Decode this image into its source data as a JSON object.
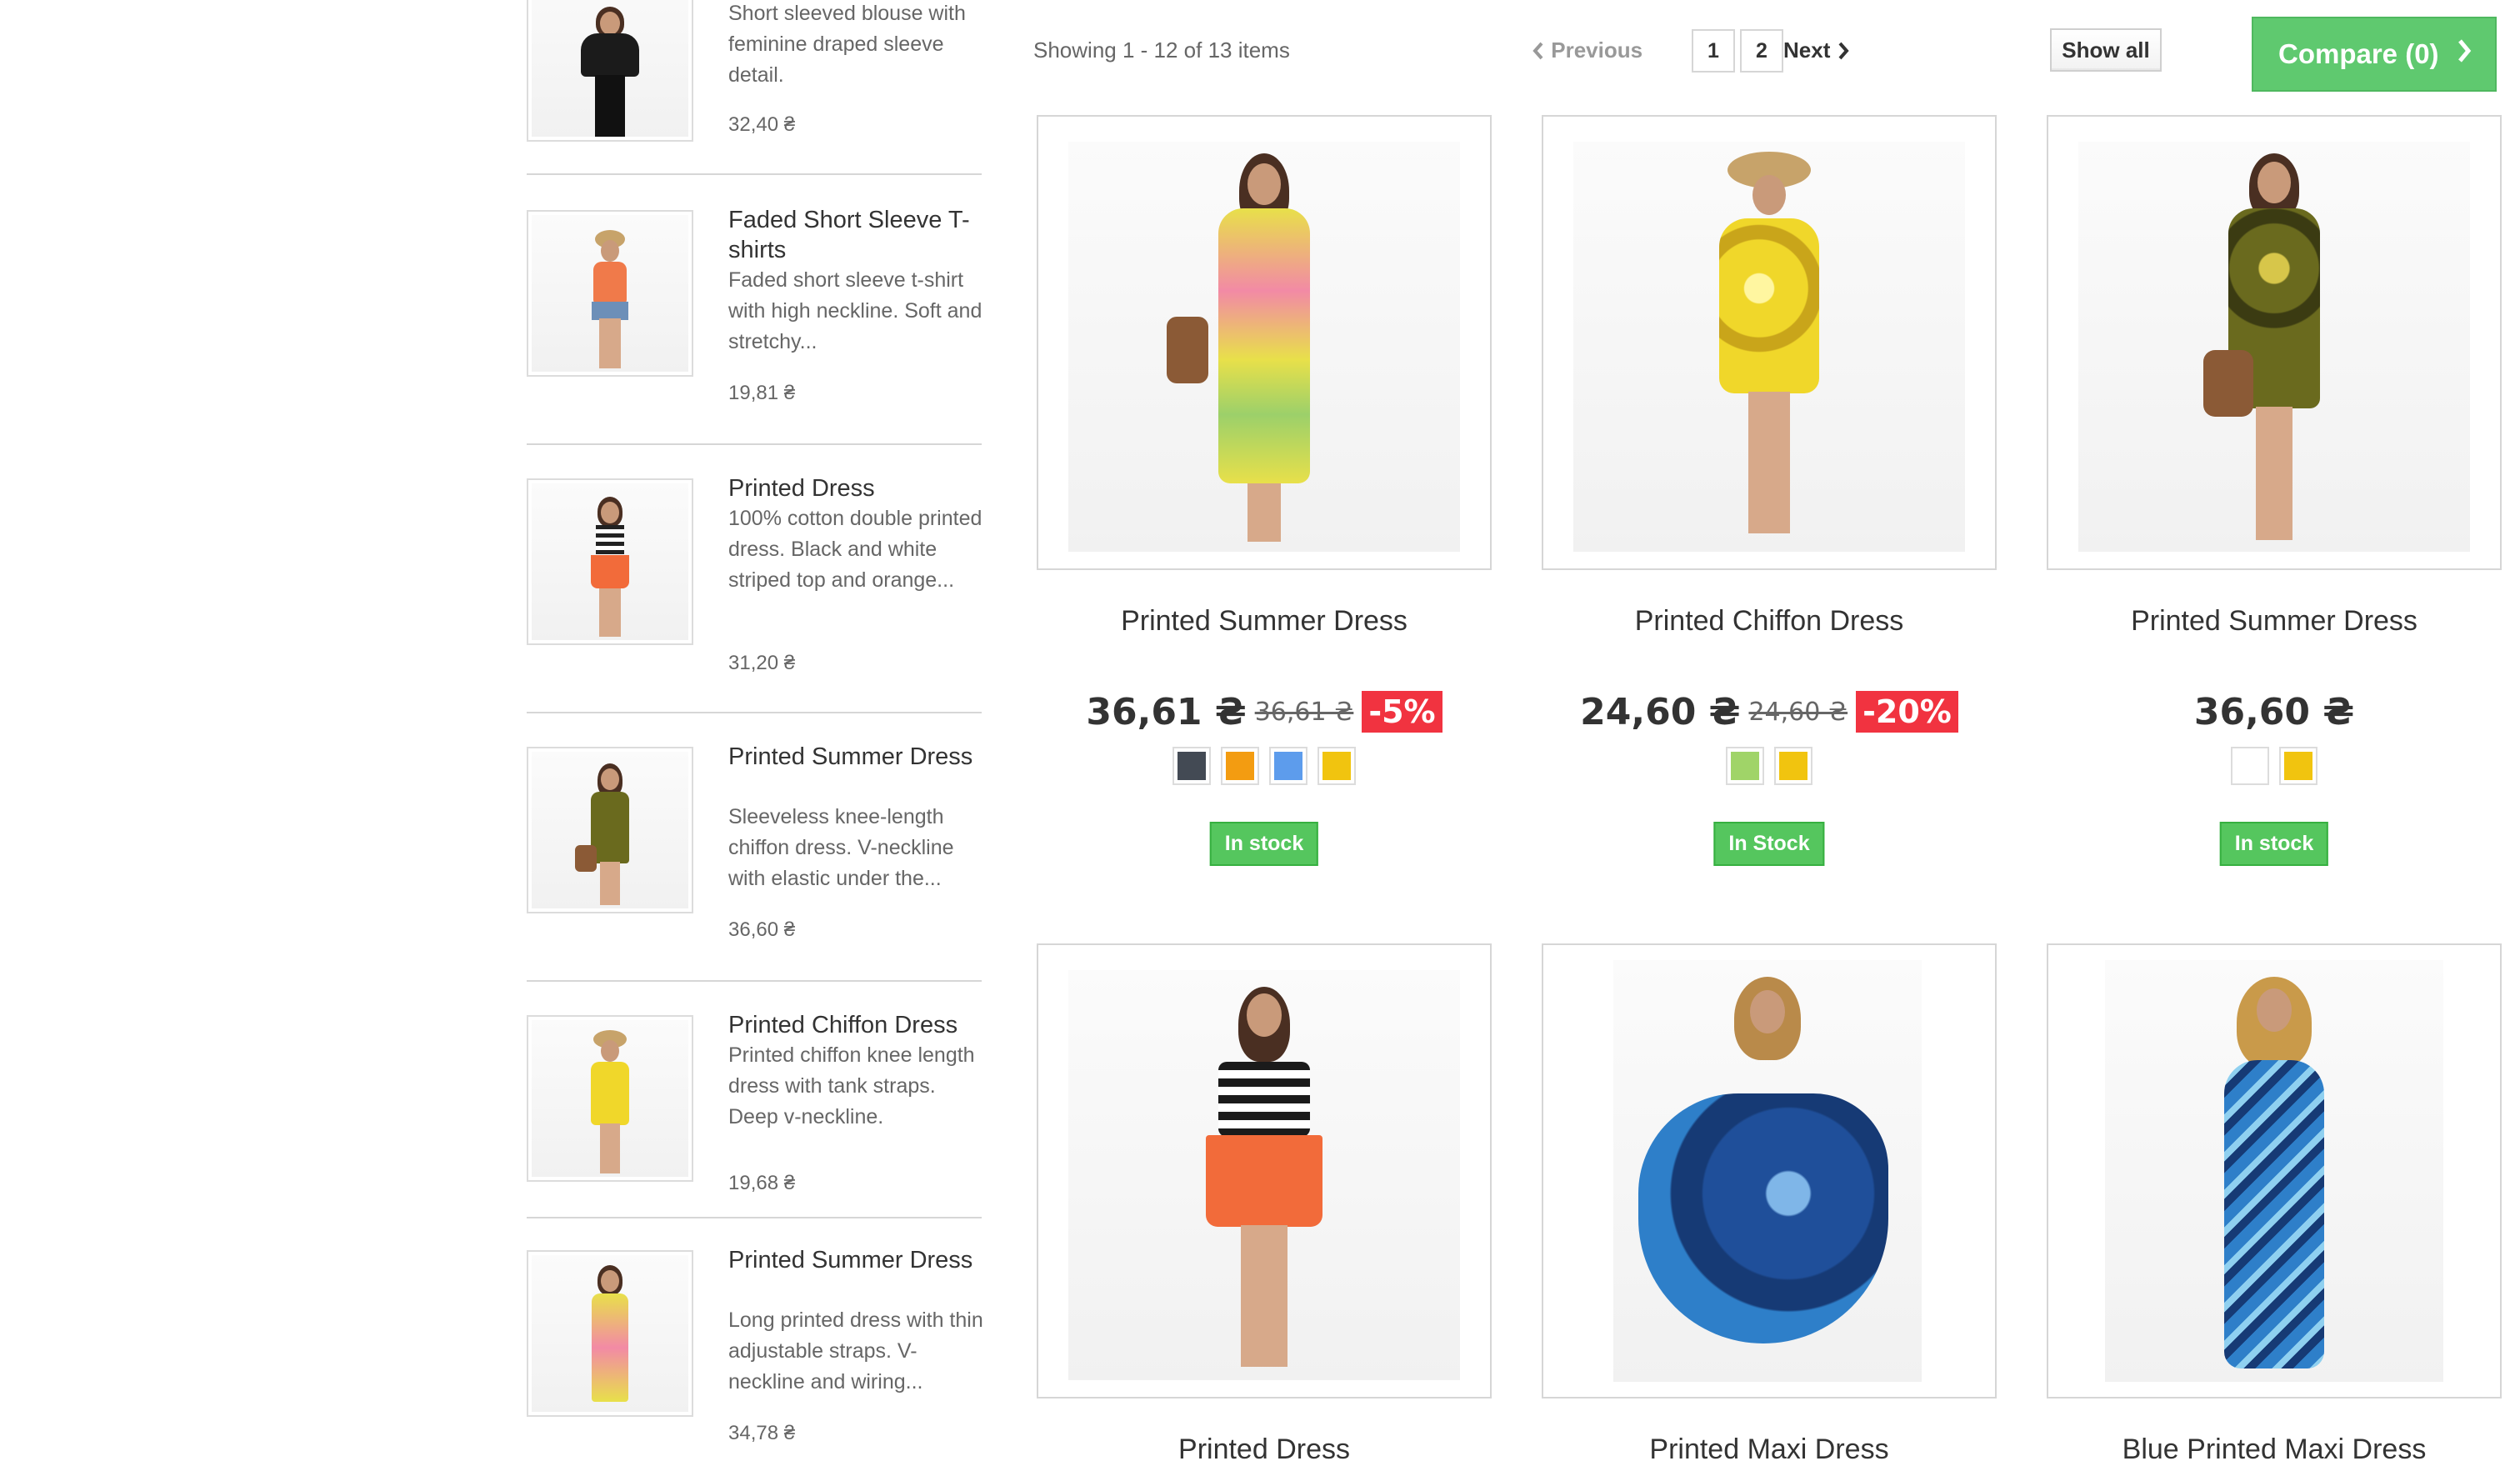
{
  "sidebar": {
    "items": [
      {
        "title": "",
        "desc": "Short sleeved blouse with feminine draped sleeve detail.",
        "price": "32,40 ₴"
      },
      {
        "title": "Faded Short Sleeve T-shirts",
        "desc": "Faded short sleeve t-shirt with high neckline. Soft and stretchy...",
        "price": "19,81 ₴"
      },
      {
        "title": "Printed Dress",
        "desc": "100% cotton double printed dress. Black and white striped top and orange...",
        "price": "31,20 ₴"
      },
      {
        "title": "Printed Summer Dress",
        "desc": "Sleeveless knee-length chiffon dress. V-neckline with elastic under the...",
        "price": "36,60 ₴"
      },
      {
        "title": "Printed Chiffon Dress",
        "desc": "Printed chiffon knee length dress with tank straps. Deep v-neckline.",
        "price": "19,68 ₴"
      },
      {
        "title": "Printed Summer Dress",
        "desc": "Long printed dress with thin adjustable straps. V-neckline and wiring...",
        "price": "34,78 ₴"
      }
    ]
  },
  "toolbar": {
    "showing": "Showing 1 - 12 of 13 items",
    "previous": "Previous",
    "page1": "1",
    "page2": "2",
    "next": "Next",
    "show_all": "Show all",
    "compare": "Compare (0)"
  },
  "products": [
    {
      "title": "Printed Summer Dress",
      "price": "36,61 ₴",
      "old_price": "36,61 ₴",
      "discount": "-5%",
      "colors": [
        "#434a54",
        "#f39c11",
        "#5d9cec",
        "#f1c40f"
      ],
      "stock": "In stock",
      "figure_color": "#e8e04a"
    },
    {
      "title": "Printed Chiffon Dress",
      "price": "24,60 ₴",
      "old_price": "24,60 ₴",
      "discount": "-20%",
      "colors": [
        "#a0d468",
        "#f1c40f"
      ],
      "stock": "In Stock",
      "figure_color": "#f0d72a"
    },
    {
      "title": "Printed Summer Dress",
      "price": "36,60 ₴",
      "old_price": "",
      "discount": "",
      "colors": [
        "#ffffff",
        "#f1c40f"
      ],
      "stock": "In stock",
      "figure_color": "#6a6a1e"
    },
    {
      "title": "Printed Dress",
      "figure_color": "#f26b3a"
    },
    {
      "title": "Printed Maxi Dress",
      "figure_color": "#1f4f9a"
    },
    {
      "title": "Blue Printed Maxi Dress",
      "figure_color": "#2e7fc9"
    }
  ],
  "colors": {
    "compare_green": "#5fc96f",
    "stock_green": "#55c65e",
    "discount_red": "#f13340"
  },
  "icons": {
    "prev": "chevron-left-icon",
    "next": "chevron-right-icon",
    "compare": "chevron-right-icon"
  }
}
